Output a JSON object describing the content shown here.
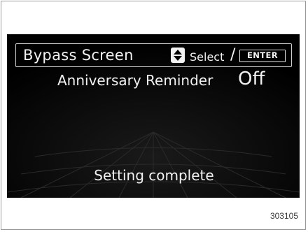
{
  "header": {
    "title": "Bypass Screen",
    "select_label": "Select",
    "separator": "/",
    "enter_label": "ENTER",
    "updown_icon": "up-down-arrows-icon"
  },
  "setting": {
    "label": "Anniversary Reminder",
    "value": "Off"
  },
  "status": {
    "message": "Setting complete"
  },
  "figure": {
    "code": "303105"
  },
  "colors": {
    "screen_background": "#000000",
    "display_text": "#f2f2f2",
    "frame_border": "#9a9a9a"
  }
}
